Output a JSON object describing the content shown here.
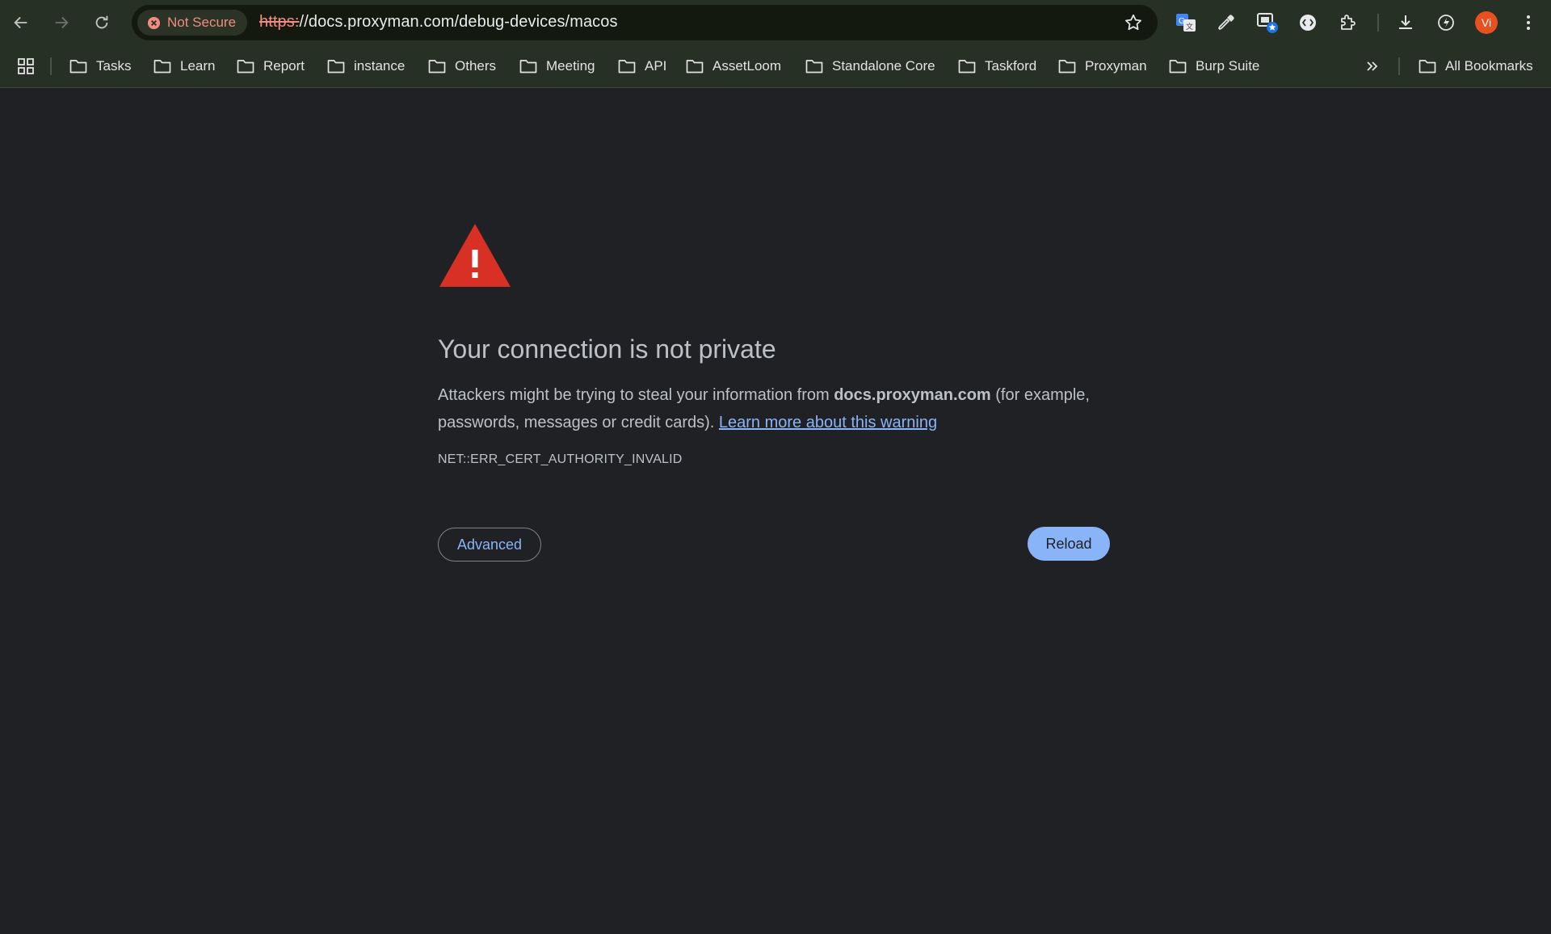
{
  "browser": {
    "security_chip": "Not Secure",
    "url_scheme": "https:",
    "url_rest": "//docs.proxyman.com/debug-devices/macos",
    "avatar_initials": "Vi"
  },
  "bookmarks": {
    "items": [
      "Tasks",
      "Learn",
      "Report",
      "instance",
      "Others",
      "Meeting",
      "API",
      "AssetLoom",
      "Standalone Core",
      "Taskford",
      "Proxyman",
      "Burp Suite"
    ],
    "all_bookmarks": "All Bookmarks"
  },
  "interstitial": {
    "title": "Your connection is not private",
    "desc_before": "Attackers might be trying to steal your information from ",
    "desc_domain": "docs.proxyman.com",
    "desc_after": " (for example, passwords, messages or credit cards). ",
    "learn_more": "Learn more about this warning",
    "error_code": "NET::ERR_CERT_AUTHORITY_INVALID",
    "advanced_label": "Advanced",
    "reload_label": "Reload"
  },
  "colors": {
    "page_bg": "#202124",
    "toolbar_bg": "#263024",
    "warning_red": "#d93025",
    "link_blue": "#8ab4f8"
  }
}
